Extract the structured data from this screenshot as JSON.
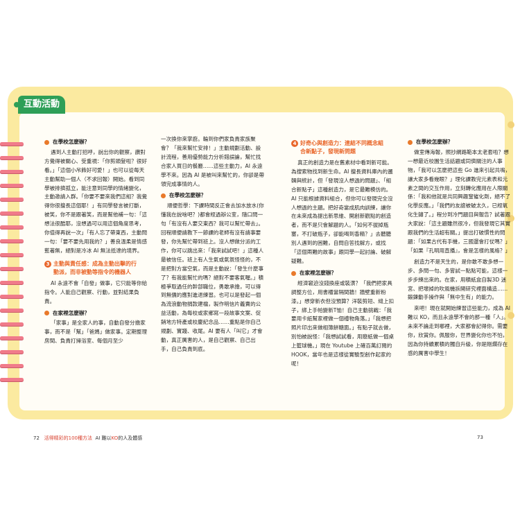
{
  "tab_label": "互動活動",
  "col1": {
    "h1": "在學校怎麼辦？",
    "p1": "遇到人主動打招呼，說出你的觀察，讚對方覺得被關心、受重視：「你剪頭髮啦？很好看。」「這個小吊飾好可愛！」也可以從每天主動幫助一個人（不求回報）開始。看到同學被排擠孤立，能注意到同學的情緒變化，主動邀請入群。「你要不要來我們這組？我覺得你很擅長這個耶！」有同學發言被打斷，被笑，你不是跟著笑，而是幫他補一句：「這想法很酷耶，沒想過可以用這個角度思考，你值得再說一次」「有人忘了帶東西，主動問一句：「要不要先用我的？」善良溫柔是情感藍著無，絕對是冷冰 AI 無法抵達的境界。",
    "sec_num": "3",
    "sec_t1": "主動與責任感：成為主動出擊的行",
    "sec_t2": "動派，而非被動等指令的機器人",
    "p2": "AI 永遠不會「自發」做事，它只能等你給指令。人能自己觀察、行動，並對結果負責。",
    "h2": "在家裡怎麼辦？",
    "p3": "「家事」是全家人的事，自動自發分擔家事，而不是「幫」「爸媽」做家事。定期整理房間、負責打掃浴室、每個月至少"
  },
  "col2": {
    "p1": "一次換你來掌廚。輪到你們家負責家族聚會？「我來幫忙安排！」主動規劃活動、設計流程，善用優勢能力分析錯誤論，幫忙找合家人買日的餐廳……這些主動力，AI 永遠學不來。因為 AI 是被叫來幫忙的，你卻是帶領完成事情的人。",
    "h1": "在學校怎麼辦？",
    "p2": "順便哲學：下課時間反正會去加水放水(你懂我在說啥吧？)都會經過辦公室，隨口問一句「有沒有人要交東西？我可以幫忙帶去」。回程順便請教下一節課的老師有沒有請事要發，你先幫忙帶到班上。沒人想做分派的工作，你可以跳出來：「我來試試吧！」這種人最被信任。班上有人生氣或氣氛怪怪的，不是把對方當空氣，而是主動說：「發生什麼事了？有我能幫忙的嗎？絕對不要客氣喔。」積極爭取過任的幹部職位，勇敢承擔，可以得到無價的應對進退練習。也可以是發起一個為流浪動物捐款建檔，製作明信片義賣的公益活動，為每校或家鄉寫一段故事文案、促銷地方特產或校慶紀念品……重點是你自己規劃、實踐、收尾。AI 要有人「叫它」才會動，真正厲害的人，是自己觀察、自己出手，自己負責到底。"
  },
  "col3": {
    "sec_num": "4",
    "sec_t1": "好奇心與創造力：連結不同概念組",
    "sec_t2": "合新點子，發現新問題",
    "p1": "真正的創造力是在舊素材中看到新可能。為搜索物找到新生命。AI 擅長資料庫內的邏輯與統計，但「發現沒人想過的問題」、「組合新點子」這種創造力，是它最難模仿的。AI 只能根據資料組合，但你可以發現完全沒人想過的主題。把好奇當成肌肉訓練，讓你在未來成為提出新思維、開創新觀點的創造者，而不是只會解題的人。「如何不拔掉瓶塞，不打破瓶子，卻能喝到香精？」去聽聽別人遇到的困難，自問自答找解方，或找「這個兩難的故事」跟同學一起討論、破解疑難。",
    "h1": "在家裡怎麼辦？",
    "p2": "經濟窘迫沒錢換座或裝潢？「我們把家具調整方位，用書櫃當隔間牆！牆壁重新粉漆。」想穿新衣但沒預算？洋裝剪短、縫上扣子，綁上手帕變新T恤！自己主動挑戰：「我要用卡紙幫家裡做一個禮物角落。」「我想把照片印出來做相簿餅糖面。」有點子就去做，別怕被說怪：「我想試試看，用廢紙做一個桌上籃球機。」現在 Youtube 上確百萬訂閱的 HOOK，當年也是這樣從實驗型創作起家的呢！"
  },
  "col4": {
    "h1": "在學校怎麼辦？",
    "p1": "做室傳海報，照抄網路範本太老套啦？想一想最近校園生活話題或同儕關注的人事物，「我可以怎麼把這些 Go 進來引起共鳴，讓大家多看幾眼？」理化課教完元素表和元素之間的交互作用，立刻轉化應用在人際關係：「我和他就是共同興趣窒催化劑，絕不了化學反應。」「我們的友誼被破太久，已經氧化生鏽了。」程分到冷門題目與報告？試著跟大家說：「這主題雖然很冷，但我發現它其實跟我們的生活超有關。」提出打破慣性的問題：「如果古代有手機，三國還會打仗嗎？」「如果『孔明用直播』，會是怎樣的風格？」",
    "p2": "創造力不是天生的，是你敢不敢多想一步、多問一句、多嘗試一點點可能，這樣一步步練出來的。在家，用積紙盒自製3D 迷宮、把壞掉的吹風機拆開研究裡面構造……鍛鍊動手操作與「無中生有」的能力。",
    "p3": "來吧！現在就開始練習這些能力，成為 AI 難以 KO，而且永遠學不會的那一種「人」。未來不論走到哪裡，大家都會記得你。需要你，欣賞你。佩服你，世界變化你也不怕，因為你持續累積的獨自升級，你是剛爛存在感的厲害中學生！"
  },
  "footer": {
    "left_page": "72",
    "left_title_a": "活得精彩的100種方法",
    "left_title_b": "AI 難以",
    "left_title_c": "KO",
    "left_title_d": "的人及體感",
    "right_page": "73"
  }
}
